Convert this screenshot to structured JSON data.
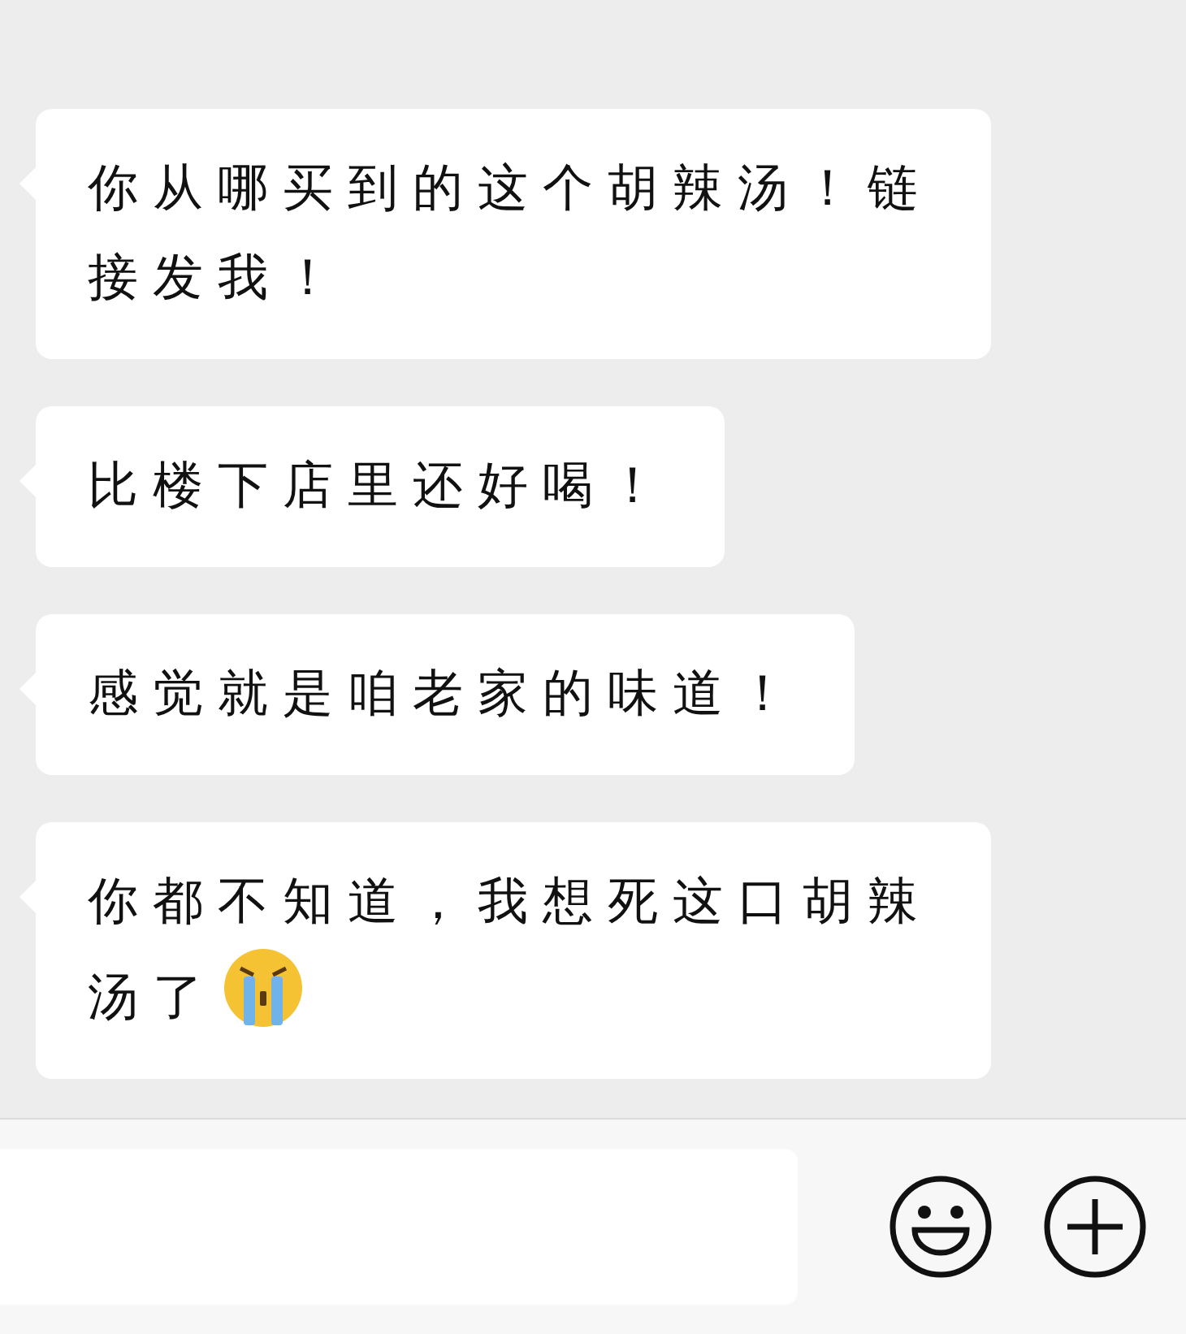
{
  "messages": [
    {
      "kind": "text",
      "text": "你从哪买到的这个胡辣汤！链接发我！"
    },
    {
      "kind": "text",
      "text": "比楼下店里还好喝！"
    },
    {
      "kind": "text",
      "text": "感觉就是咱老家的味道！"
    },
    {
      "kind": "text_with_emoji",
      "text": "你都不知道，我想死这口胡辣汤了"
    }
  ]
}
